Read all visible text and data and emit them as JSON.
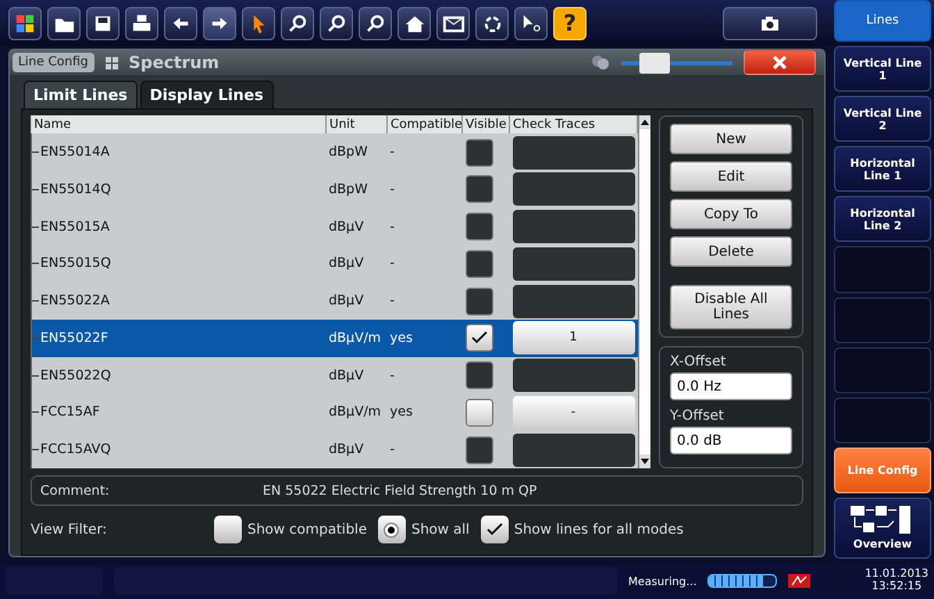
{
  "toolbar": {
    "help_label": "?"
  },
  "dialog": {
    "tab_label": "Line Config",
    "title": "Spectrum",
    "opacity_slider": {
      "level": 0.3
    },
    "tabs": [
      {
        "label": "Limit Lines",
        "selected": true
      },
      {
        "label": "Display Lines",
        "selected": false
      }
    ],
    "table": {
      "columns": [
        "Name",
        "Unit",
        "Compatible",
        "Visible",
        "Check Traces"
      ],
      "rows": [
        {
          "name": "EN55014A",
          "unit": "dBpW",
          "compatible": "-",
          "visible": false,
          "disabled": true,
          "check_traces": "",
          "selected": false
        },
        {
          "name": "EN55014Q",
          "unit": "dBpW",
          "compatible": "-",
          "visible": false,
          "disabled": true,
          "check_traces": "",
          "selected": false
        },
        {
          "name": "EN55015A",
          "unit": "dBµV",
          "compatible": "-",
          "visible": false,
          "disabled": true,
          "check_traces": "",
          "selected": false
        },
        {
          "name": "EN55015Q",
          "unit": "dBµV",
          "compatible": "-",
          "visible": false,
          "disabled": true,
          "check_traces": "",
          "selected": false
        },
        {
          "name": "EN55022A",
          "unit": "dBµV",
          "compatible": "-",
          "visible": false,
          "disabled": true,
          "check_traces": "",
          "selected": false
        },
        {
          "name": "EN55022F",
          "unit": "dBµV/m",
          "compatible": "yes",
          "visible": true,
          "disabled": false,
          "check_traces": "1",
          "selected": true
        },
        {
          "name": "EN55022Q",
          "unit": "dBµV",
          "compatible": "-",
          "visible": false,
          "disabled": true,
          "check_traces": "",
          "selected": false
        },
        {
          "name": "FCC15AF",
          "unit": "dBµV/m",
          "compatible": "yes",
          "visible": false,
          "disabled": false,
          "check_traces": "-",
          "selected": false
        },
        {
          "name": "FCC15AVQ",
          "unit": "dBµV",
          "compatible": "-",
          "visible": false,
          "disabled": true,
          "check_traces": "",
          "selected": false
        }
      ]
    },
    "buttons": [
      "New",
      "Edit",
      "Copy To",
      "Delete"
    ],
    "disable_all_button": "Disable All Lines",
    "x_offset": {
      "label": "X-Offset",
      "value": "0.0 Hz"
    },
    "y_offset": {
      "label": "Y-Offset",
      "value": "0.0 dB"
    },
    "comment": {
      "label": "Comment:",
      "value": "EN 55022 Electric Field Strength 10 m QP"
    },
    "view_filter": {
      "label": "View Filter:",
      "options": [
        {
          "kind": "radio",
          "label": "Show compatible",
          "checked": false
        },
        {
          "kind": "radio",
          "label": "Show all",
          "checked": true
        },
        {
          "kind": "checkbox",
          "label": "Show lines for all modes",
          "checked": true
        }
      ]
    }
  },
  "softkeys": [
    {
      "kind": "header",
      "label": "Lines",
      "selected": true
    },
    {
      "kind": "key",
      "label": "Vertical Line 1",
      "selected": false
    },
    {
      "kind": "key",
      "label": "Vertical Line 2",
      "selected": false
    },
    {
      "kind": "key",
      "label": "Horizontal Line 1",
      "selected": false
    },
    {
      "kind": "key",
      "label": "Horizontal Line 2",
      "selected": false
    },
    {
      "kind": "empty",
      "selected": false
    },
    {
      "kind": "empty",
      "selected": false
    },
    {
      "kind": "empty",
      "selected": false
    },
    {
      "kind": "empty",
      "selected": false
    },
    {
      "kind": "key",
      "label": "Line Config",
      "selected": true
    },
    {
      "kind": "overview",
      "label": "Overview",
      "selected": false
    }
  ],
  "status_bar": {
    "state": "Measuring...",
    "level": 0.8,
    "date": "11.01.2013",
    "time": "13:52:15"
  }
}
